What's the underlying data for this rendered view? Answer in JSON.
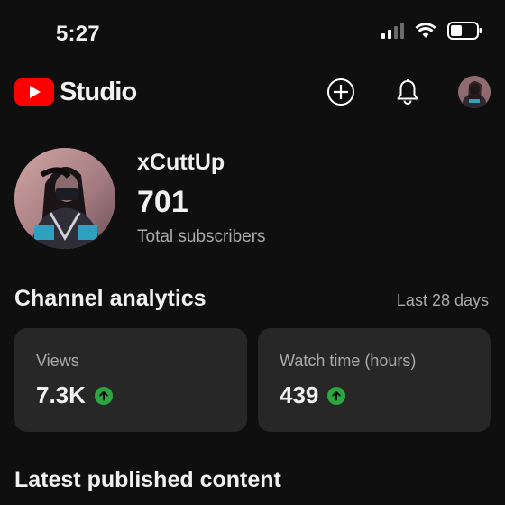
{
  "status": {
    "time": "5:27"
  },
  "header": {
    "logo_text": "Studio"
  },
  "channel": {
    "name": "xCuttUp",
    "subscribers": "701",
    "subscribers_label": "Total subscribers"
  },
  "analytics": {
    "title": "Channel analytics",
    "range": "Last 28 days",
    "cards": [
      {
        "label": "Views",
        "value": "7.3K",
        "trend": "up"
      },
      {
        "label": "Watch time (hours)",
        "value": "439",
        "trend": "up"
      }
    ]
  },
  "latest": {
    "title": "Latest published content"
  },
  "colors": {
    "background": "#0f0f0f",
    "card": "#272727",
    "brand": "#ff0000",
    "trend_up": "#2ba640",
    "muted": "#aaaaaa"
  }
}
